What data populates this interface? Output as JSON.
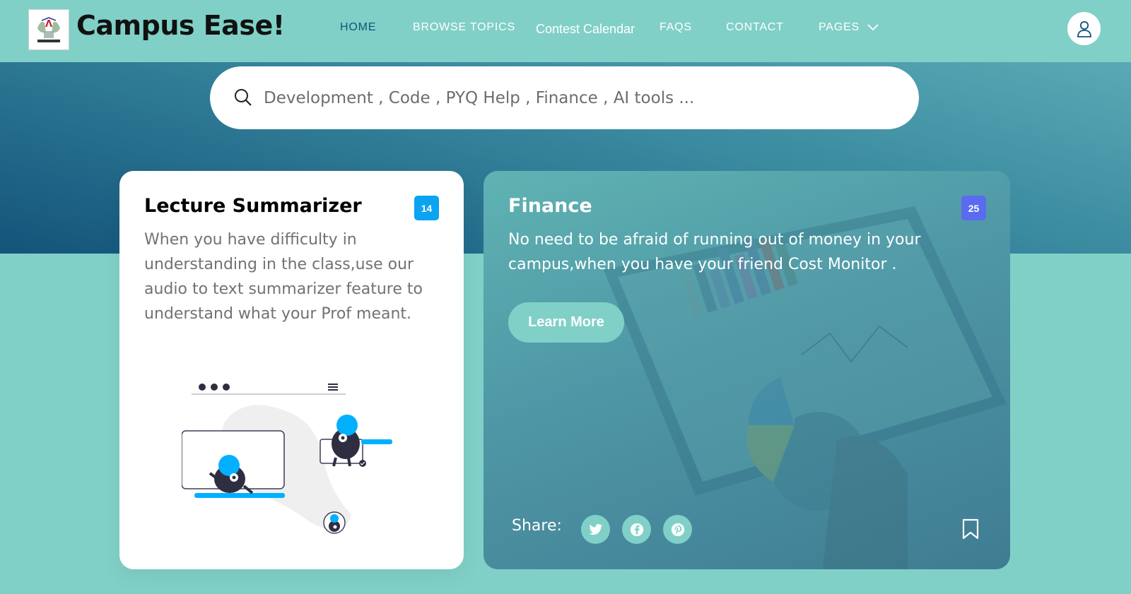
{
  "brand": {
    "name": "Campus Ease!",
    "logo_icon": "college-emblem-icon"
  },
  "nav": {
    "items": [
      {
        "label": "HOME",
        "active": true
      },
      {
        "label": "BROWSE TOPICS"
      },
      {
        "label": "Contest Calendar"
      },
      {
        "label": "FAQS"
      },
      {
        "label": "CONTACT"
      },
      {
        "label": "PAGES",
        "dropdown": true
      }
    ],
    "user_icon": "user-icon"
  },
  "search": {
    "placeholder": "Development , Code , PYQ Help , Finance , AI tools ...",
    "icon": "search-icon"
  },
  "cards": {
    "lecture": {
      "title": "Lecture Summarizer",
      "badge": "14",
      "badge_color": "#0aa4f0",
      "text": "When you have difficulty in understanding in the class,use our audio to text summarizer feature to understand what your Prof meant."
    },
    "finance": {
      "title": "Finance",
      "badge": "25",
      "badge_color": "#5b6bf0",
      "text": "No need to be afraid of running out of money in your campus,when you have your friend Cost Monitor .",
      "button": "Learn More",
      "share_label": "Share:",
      "share_icons": [
        "twitter-icon",
        "facebook-icon",
        "pinterest-icon"
      ],
      "bookmark_icon": "bookmark-icon"
    }
  },
  "colors": {
    "primary": "#80d0c7",
    "secondary": "#13547a",
    "white": "#ffffff"
  }
}
